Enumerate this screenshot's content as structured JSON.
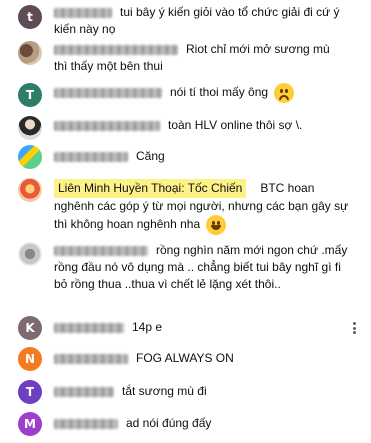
{
  "comments": [
    {
      "avatar_letter": "t",
      "avatar_color": "#5f4b55",
      "text": "tui bây ý kiến giỏi vào tổ chức giải đi cứ ý kiến này nọ"
    },
    {
      "avatar_letter": "",
      "text": "Riot chỉ mới mở sương mù thì thấy một bên thui"
    },
    {
      "avatar_letter": "T",
      "avatar_color": "#2e7d68",
      "text": "nói tí thoi mấy ông",
      "emoji": "sad-face-icon"
    },
    {
      "avatar_letter": "",
      "text": "toàn HLV online thôi sợ \\."
    },
    {
      "avatar_letter": "",
      "text": "Căng"
    },
    {
      "avatar_letter": "",
      "badge": "Liên Minh Huyền Thoại: Tốc Chiến",
      "text": "BTC hoan nghênh các góp ý từ mọi người, nhưng các bạn gây sự thì không hoan nghênh nha",
      "emoji": "grinning-face-icon"
    },
    {
      "avatar_letter": "",
      "text": "rồng nghìn năm mới ngon chứ .mấy rồng đầu nó vô dụng mà .. chẳng biết tui bây nghĩ gì fi bỏ rồng thua ..thua vì chết lẻ lặng xét thôi.."
    },
    {
      "avatar_letter": "K",
      "avatar_color": "#7d6a6e",
      "text": "14p e"
    },
    {
      "avatar_letter": "N",
      "avatar_color": "#f47b20",
      "text": "FOG ALWAYS ON"
    },
    {
      "avatar_letter": "T",
      "avatar_color": "#6f3fc1",
      "text": "tắt sương mù đi"
    },
    {
      "avatar_letter": "M",
      "avatar_color": "#9c3fc9",
      "text": "ad nói đúng đấy"
    }
  ]
}
